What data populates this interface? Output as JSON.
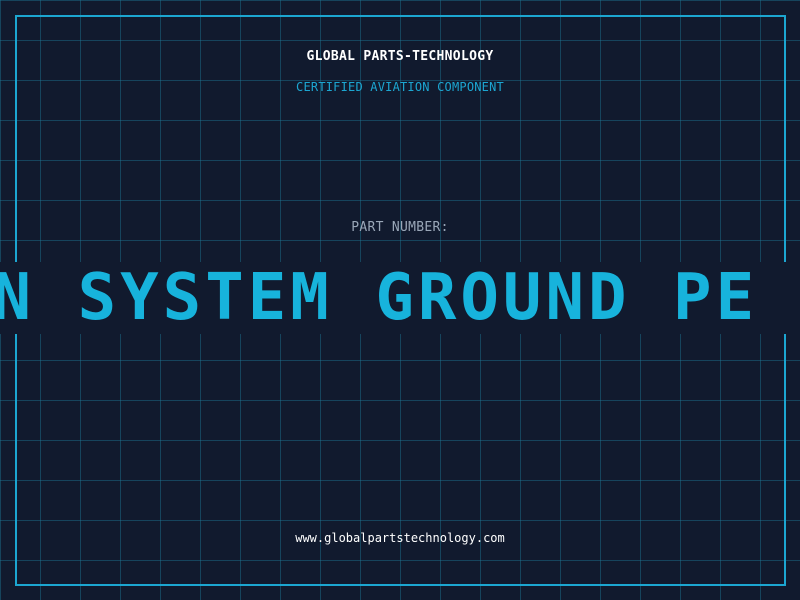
{
  "header": {
    "company": "GLOBAL PARTS-TECHNOLOGY",
    "subtitle": "CERTIFIED AVIATION COMPONENT"
  },
  "part": {
    "label": "PART NUMBER:",
    "value": "AN SYSTEM GROUND PE"
  },
  "footer": {
    "website": "www.globalpartstechnology.com"
  },
  "colors": {
    "background": "#111a2e",
    "accent": "#1ca6d1",
    "part_number": "#17b3dc",
    "label": "#9aa7b8",
    "text": "#ffffff"
  }
}
